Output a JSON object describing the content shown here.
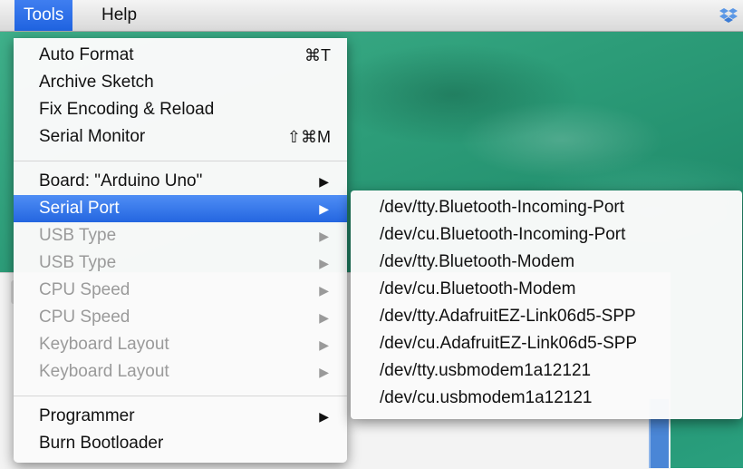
{
  "menubar": {
    "items": [
      "Tools",
      "Help"
    ]
  },
  "tools_menu": {
    "items": [
      {
        "label": "Auto Format",
        "shortcut": "⌘T"
      },
      {
        "label": "Archive Sketch"
      },
      {
        "label": "Fix Encoding & Reload"
      },
      {
        "label": "Serial Monitor",
        "shortcut": "⇧⌘M"
      },
      {
        "label": "Board: \"Arduino Uno\"",
        "arrow": "▶"
      },
      {
        "label": "Serial Port",
        "arrow": "▶",
        "selected": true
      },
      {
        "label": "USB Type",
        "arrow": "▶",
        "disabled": true
      },
      {
        "label": "USB Type",
        "arrow": "▶",
        "disabled": true
      },
      {
        "label": "CPU Speed",
        "arrow": "▶",
        "disabled": true
      },
      {
        "label": "CPU Speed",
        "arrow": "▶",
        "disabled": true
      },
      {
        "label": "Keyboard Layout",
        "arrow": "▶",
        "disabled": true
      },
      {
        "label": "Keyboard Layout",
        "arrow": "▶",
        "disabled": true
      },
      {
        "label": "Programmer",
        "arrow": "▶"
      },
      {
        "label": "Burn Bootloader"
      }
    ]
  },
  "serial_port_submenu": {
    "items": [
      "/dev/tty.Bluetooth-Incoming-Port",
      "/dev/cu.Bluetooth-Incoming-Port",
      "/dev/tty.Bluetooth-Modem",
      "/dev/cu.Bluetooth-Modem",
      "/dev/tty.AdafruitEZ-Link06d5-SPP",
      "/dev/cu.AdafruitEZ-Link06d5-SPP",
      "/dev/tty.usbmodem1a12121",
      "/dev/cu.usbmodem1a12121"
    ]
  },
  "icons": {
    "status_icon": "dropbox-icon"
  },
  "colors": {
    "selection": "#2466e0",
    "disabled_text": "#9a9a9a",
    "desktop": "#2c9c78"
  }
}
